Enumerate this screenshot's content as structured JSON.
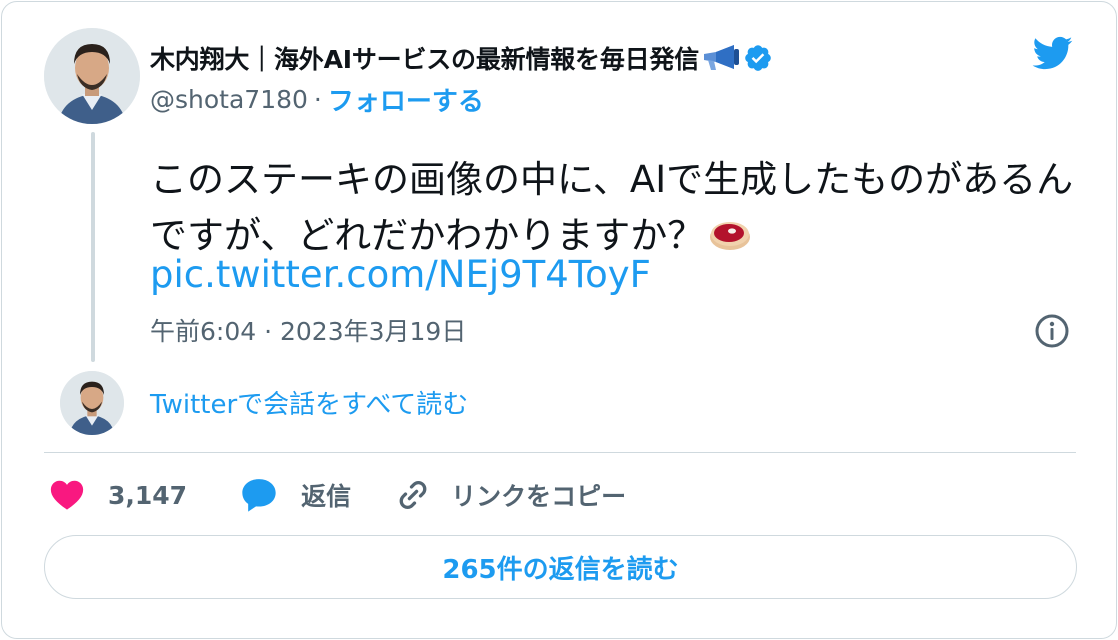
{
  "author": {
    "display_name": "木内翔大｜海外AIサービスの最新情報を毎日発信",
    "handle": "@shota7180",
    "separator": "·",
    "follow_label": "フォローする",
    "verified_icon": "verified-badge-icon",
    "name_emoji": "megaphone-icon"
  },
  "tweet": {
    "text": "このステーキの画像の中に、AIで生成したものがあるんですが、どれだかわかりますか？",
    "emoji": "steak-icon",
    "link": "pic.twitter.com/NEj9T4ToyF",
    "timestamp": "午前6:04 · 2023年3月19日"
  },
  "conversation": {
    "read_all_label": "Twitterで会話をすべて読む"
  },
  "actions": {
    "like_count": "3,147",
    "reply_label": "返信",
    "copy_link_label": "リンクをコピー"
  },
  "footer": {
    "read_replies_label": "265件の返信を読む"
  },
  "colors": {
    "accent": "#1d9bf0",
    "like": "#f91880",
    "secondary_text": "#536471",
    "border": "#cfd9de"
  }
}
